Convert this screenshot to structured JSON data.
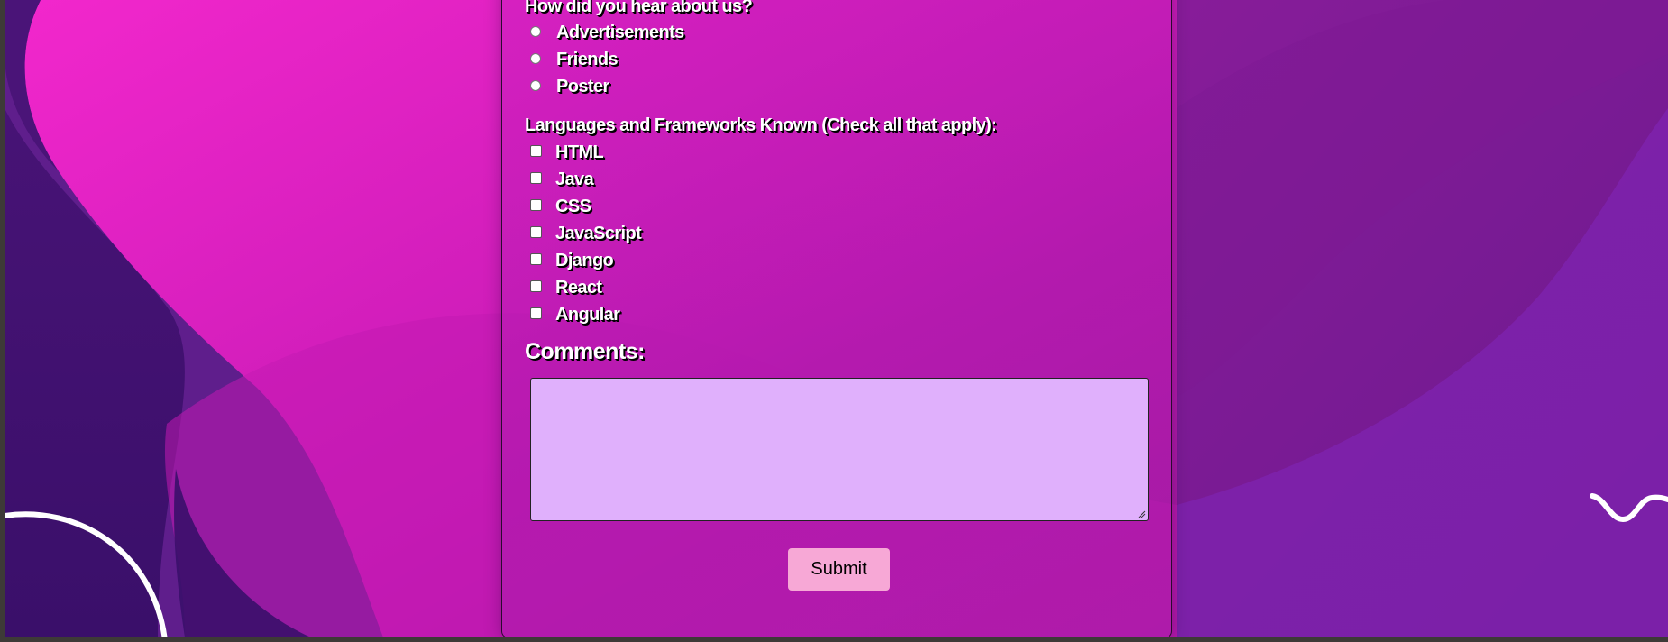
{
  "colors": {
    "page_frame": "#3d3a37",
    "bg_magenta": "#ea22c8",
    "bg_purple": "#5f1e8c",
    "textarea_bg": "#e0b0fc",
    "submit_bg": "#f7a8d6",
    "text": "#ffffff"
  },
  "form": {
    "referral": {
      "question": "How did you hear about us?",
      "options": [
        "Advertisements",
        "Friends",
        "Poster"
      ]
    },
    "languages": {
      "question": "Languages and Frameworks Known (Check all that apply):",
      "options": [
        "HTML",
        "Java",
        "CSS",
        "JavaScript",
        "Django",
        "React",
        "Angular"
      ]
    },
    "comments": {
      "label": "Comments:",
      "value": ""
    },
    "submit_label": "Submit"
  },
  "decor": {
    "icons": [
      "ring-decoration-icon",
      "wave-decoration-icon"
    ]
  }
}
